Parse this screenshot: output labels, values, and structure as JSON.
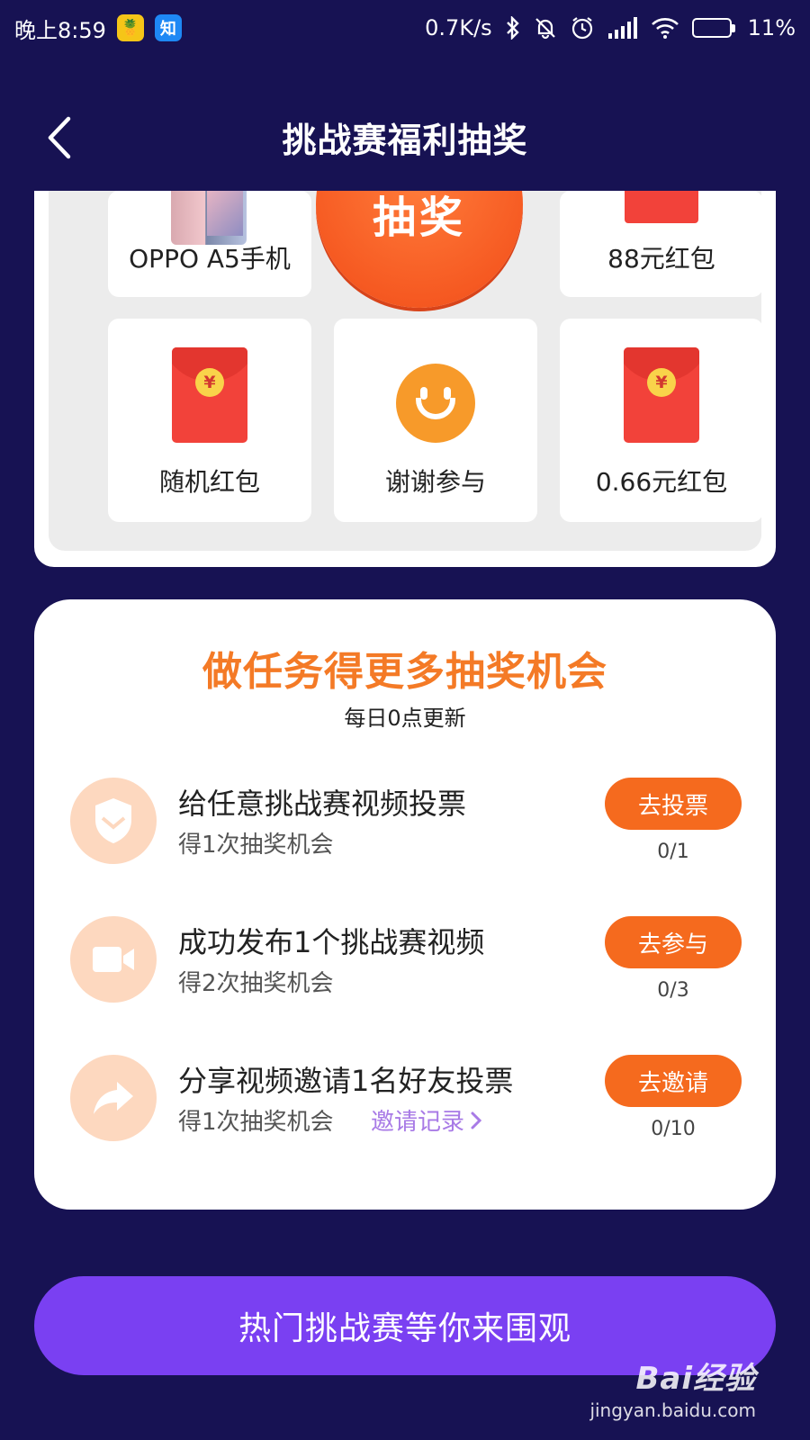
{
  "status_bar": {
    "time": "晚上8:59",
    "app_icon_1": "pineapple-app-icon",
    "app_icon_2": "知",
    "net_speed": "0.7K/s",
    "battery": "11%",
    "battery_level": 0.11,
    "battery_color": "#ff3030"
  },
  "header": {
    "title": "挑战赛福利抽奖",
    "back_icon": "chevron-left-icon"
  },
  "prizes": {
    "draw_button": "抽奖",
    "items": [
      {
        "label": "OPPO A5手机",
        "icon": "phone-icon"
      },
      {
        "label": "88元红包",
        "icon": "red-packet-icon"
      },
      {
        "label": "随机红包",
        "icon": "red-packet-icon"
      },
      {
        "label": "谢谢参与",
        "icon": "smiley-icon"
      },
      {
        "label": "0.66元红包",
        "icon": "red-packet-icon"
      }
    ],
    "coin_symbol": "¥"
  },
  "tasks": {
    "title": "做任务得更多抽奖机会",
    "subtitle": "每日0点更新",
    "items": [
      {
        "name": "给任意挑战赛视频投票",
        "reward": "得1次抽奖机会",
        "button": "去投票",
        "progress": "0/1",
        "icon": "shield-icon"
      },
      {
        "name": "成功发布1个挑战赛视频",
        "reward": "得2次抽奖机会",
        "button": "去参与",
        "progress": "0/3",
        "icon": "video-camera-icon"
      },
      {
        "name": "分享视频邀请1名好友投票",
        "reward": "得1次抽奖机会",
        "link": "邀请记录",
        "button": "去邀请",
        "progress": "0/10",
        "icon": "share-arrow-icon"
      }
    ]
  },
  "bottom_cta": "热门挑战赛等你来围观",
  "watermark": {
    "logo": "Bai经验",
    "url": "jingyan.baidu.com"
  },
  "colors": {
    "background": "#171253",
    "accent_orange": "#f56a1e",
    "title_orange": "#f47a26",
    "cta_purple": "#7a40f2",
    "link_purple": "#a87ae6",
    "icon_circle": "#fdd8bf"
  }
}
